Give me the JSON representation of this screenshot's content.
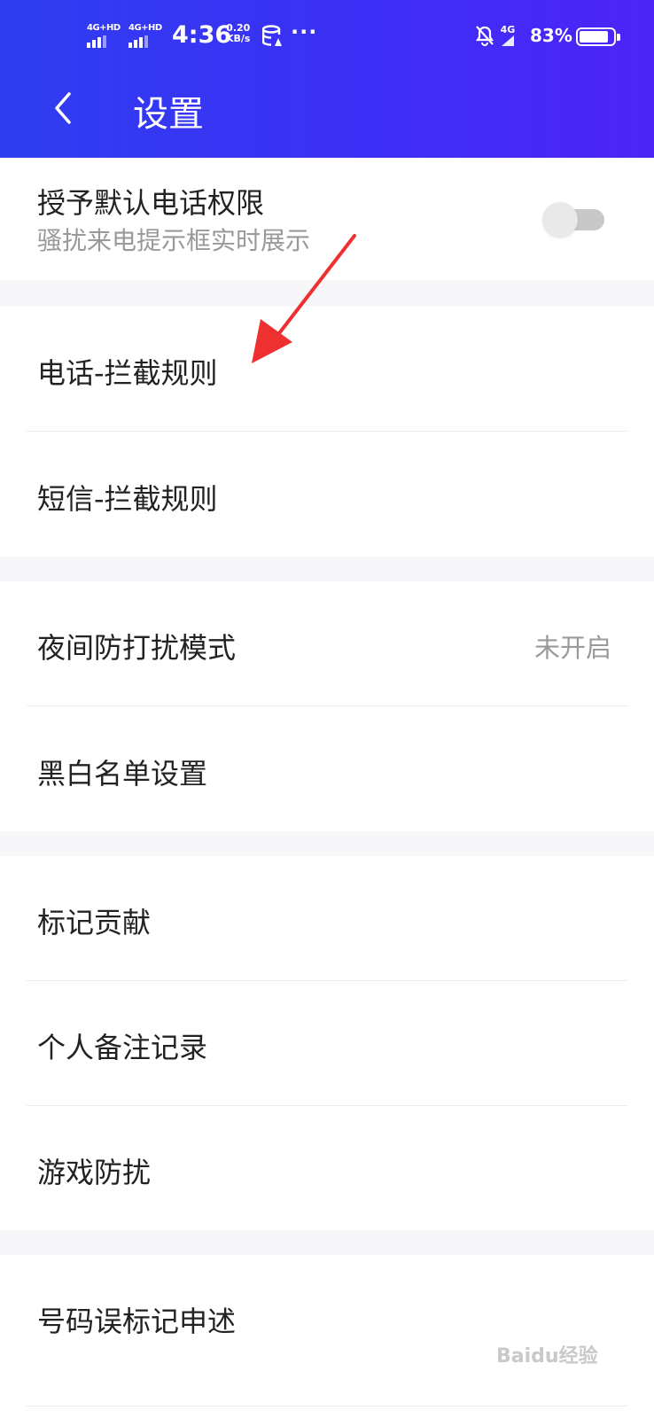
{
  "status_bar": {
    "sim1": "4G+HD",
    "sim2": "4G+HD",
    "time": "4:36",
    "speed_value": "0.20",
    "speed_unit": "KB/s",
    "more": "···",
    "network": "4G",
    "battery": "83%",
    "battery_level": 0.83
  },
  "header": {
    "title": "设置",
    "accent_color": "#3a30f2"
  },
  "default_permission": {
    "label": "授予默认电话权限",
    "sublabel": "骚扰来电提示框实时展示",
    "toggle_on": false
  },
  "intercept": {
    "call_rules": "电话-拦截规则",
    "sms_rules": "短信-拦截规则"
  },
  "modes": {
    "night_dnd": "夜间防打扰模式",
    "night_dnd_value": "未开启",
    "black_white_list": "黑白名单设置"
  },
  "records": {
    "mark_contribution": "标记贡献",
    "personal_notes": "个人备注记录",
    "game_dnd": "游戏防扰"
  },
  "appeal": {
    "misreport_appeal": "号码误标记申述"
  },
  "annotation_color": "#ee3030",
  "watermark": "Baidu经验"
}
